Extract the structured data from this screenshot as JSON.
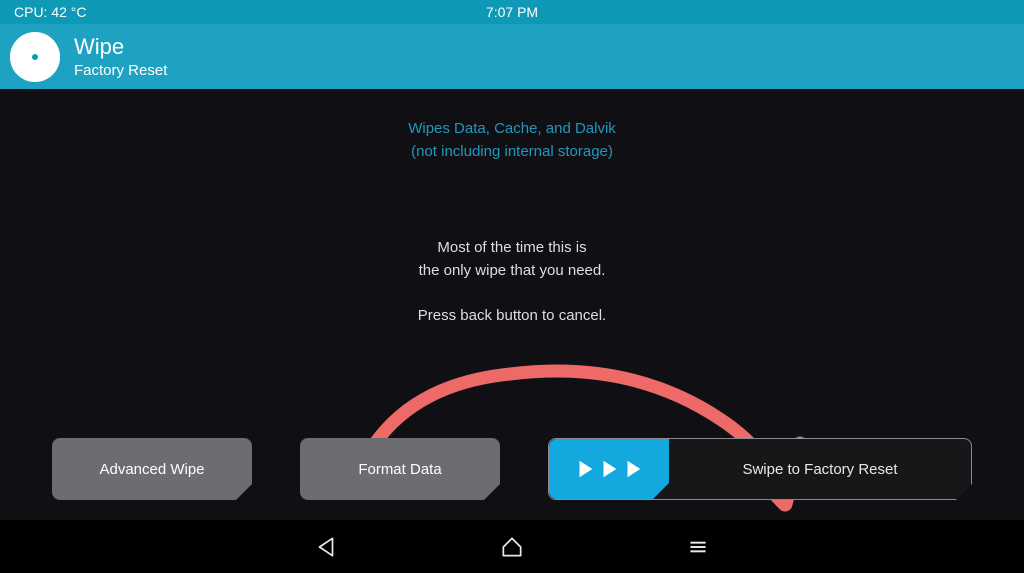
{
  "statusbar": {
    "cpu": "CPU: 42 °C",
    "clock": "7:07 PM"
  },
  "header": {
    "title": "Wipe",
    "subtitle": "Factory Reset"
  },
  "info": {
    "blue1": "Wipes Data, Cache, and Dalvik",
    "blue2": "(not including internal storage)",
    "white1": "Most of the time this is",
    "white2": "the only wipe that you need.",
    "cancel": "Press back button to cancel."
  },
  "buttons": {
    "advanced": "Advanced Wipe",
    "format": "Format Data",
    "swipe": "Swipe to Factory Reset"
  },
  "annotation": {
    "arrow_color": "#ED6A68"
  }
}
